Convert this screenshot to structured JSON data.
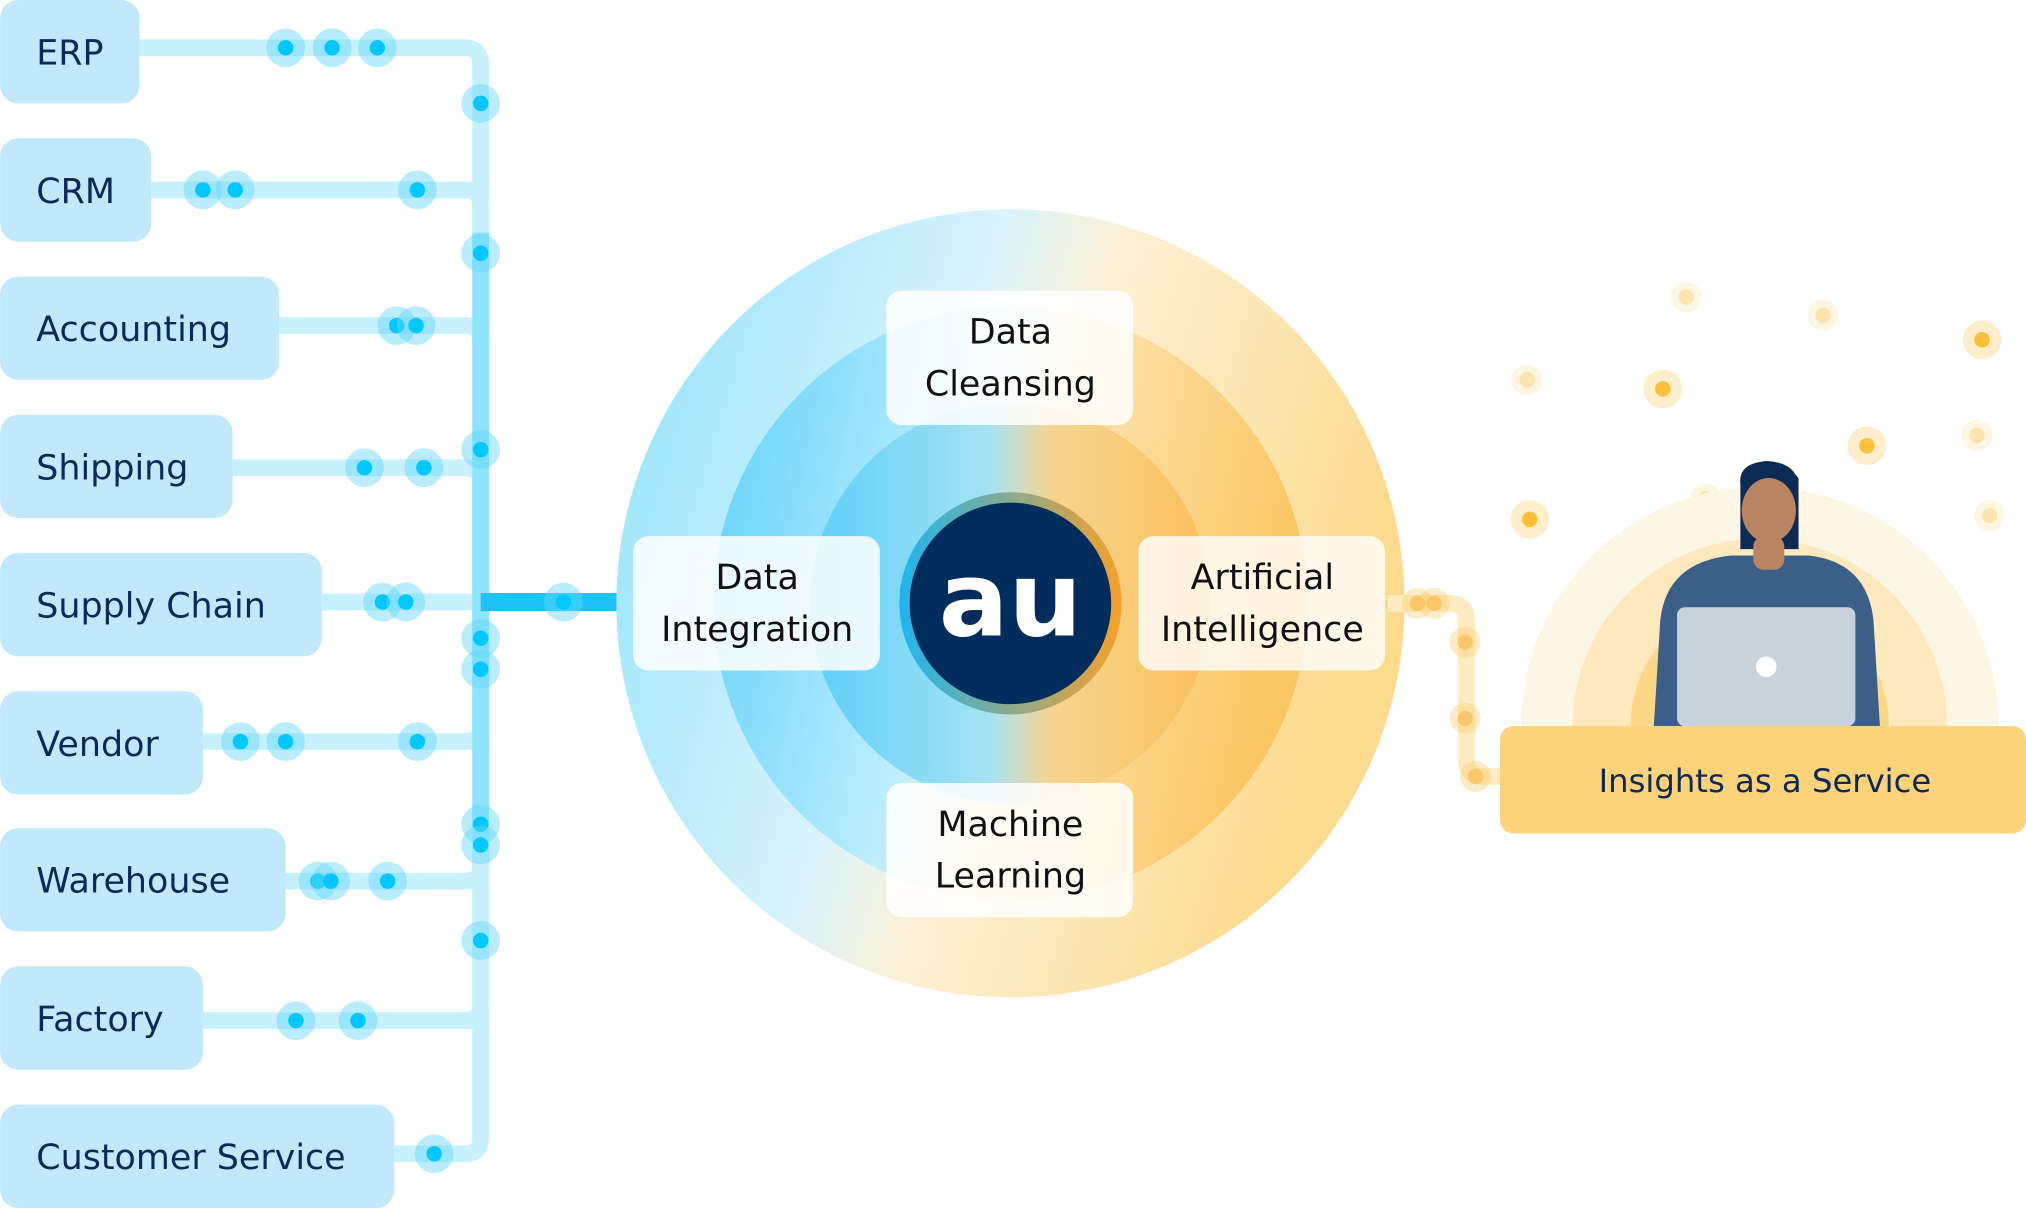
{
  "sources": [
    {
      "label": "ERP"
    },
    {
      "label": "CRM"
    },
    {
      "label": "Accounting"
    },
    {
      "label": "Shipping"
    },
    {
      "label": "Supply Chain"
    },
    {
      "label": "Vendor"
    },
    {
      "label": "Warehouse"
    },
    {
      "label": "Factory"
    },
    {
      "label": "Customer Service"
    }
  ],
  "hub": {
    "logo": "au",
    "stages": {
      "top": [
        "Data",
        "Cleansing"
      ],
      "left": [
        "Data",
        "Integration"
      ],
      "right": [
        "Artificial",
        "Intelligence"
      ],
      "bottom": [
        "Machine",
        "Learning"
      ]
    }
  },
  "output": {
    "label": "Insights as a Service"
  },
  "colors": {
    "source_box": "#c2e9fb",
    "text_dark": "#0b2a55",
    "flow_blue": "#00c8ff",
    "flow_orange": "#fbbf3a",
    "logo_bg": "#012d5c",
    "insights_box": "#fcd27b"
  }
}
